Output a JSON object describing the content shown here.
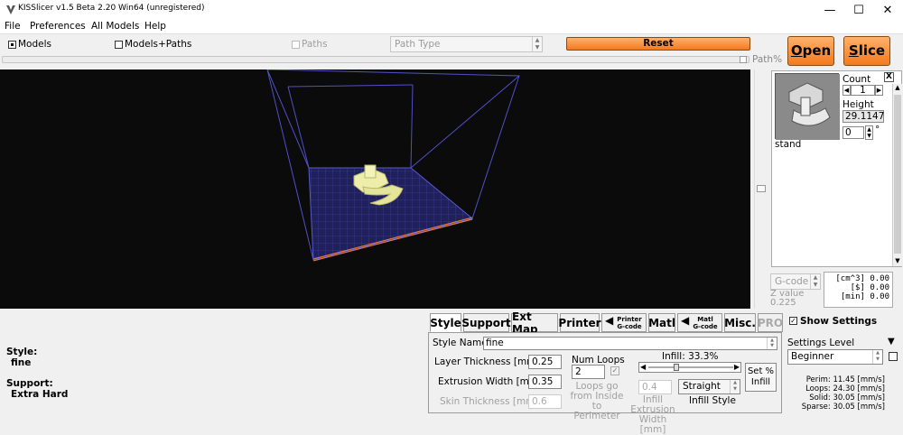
{
  "window": {
    "title": "KISSlicer v1.5 Beta 2.20 Win64 (unregistered)",
    "minimize": "—",
    "maximize": "☐",
    "close": "✕"
  },
  "menu": [
    "File",
    "Preferences",
    "All Models",
    "Help"
  ],
  "toolbar": {
    "models": "Models",
    "models_paths": "Models+Paths",
    "paths": "Paths",
    "path_type": "Path Type",
    "reset": "Reset",
    "path_pct": "Path%"
  },
  "buttons": {
    "open_pre": "",
    "open_ul": "O",
    "open_post": "pen",
    "slice_pre": "",
    "slice_ul": "S",
    "slice_post": "lice"
  },
  "model_panel": {
    "close": "X",
    "count_label": "Count",
    "count_value": "1",
    "height_label": "Height",
    "height_value": "29.1147",
    "angle_value": "0",
    "degree": "°",
    "model_name": "stand"
  },
  "gcode": {
    "combo": "G-code",
    "z_label": "Z value",
    "z_value": "0.225",
    "stats": [
      "[cm^3] 0.00",
      "[$] 0.00",
      "[min] 0.00"
    ]
  },
  "left_summary": {
    "style_label": "Style:",
    "style_value": "fine",
    "support_label": "Support:",
    "support_value": "Extra Hard"
  },
  "tabs": [
    "Style",
    "Support",
    "Ext Map",
    "Printer",
    "Matl",
    "Misc.",
    "PRO"
  ],
  "tab_printer_gcode": [
    "Printer",
    "G-code"
  ],
  "tab_matl_gcode": [
    "Matl",
    "G-code"
  ],
  "style_tab": {
    "style_name_label": "Style Name",
    "style_name_value": "fine",
    "layer_thickness_label": "Layer Thickness [mm]",
    "layer_thickness_value": "0.25",
    "extrusion_width_label": "Extrusion Width [mm]",
    "extrusion_width_value": "0.35",
    "skin_thickness_label": "Skin Thickness [mm]",
    "skin_thickness_value": "0.6",
    "num_loops_label": "Num Loops",
    "num_loops_value": "2",
    "loops_note": [
      "Loops go",
      "from Inside",
      "to Perimeter"
    ],
    "infill_label": "Infill: 33.3%",
    "infill_fraction": 0.333,
    "set_infill_label": [
      "Set %",
      "Infill"
    ],
    "infill_extrusion_label": [
      "Infill Extrusion",
      "Width [mm]"
    ],
    "infill_extrusion_value": "0.4",
    "infill_style_value": "Straight",
    "infill_style_label": "Infill Style"
  },
  "settings": {
    "show_settings": "Show Settings",
    "level_label": "Settings Level",
    "level_value": "Beginner",
    "speeds": [
      "Perim: 11.45 [mm/s]",
      "Loops: 24.30 [mm/s]",
      "Solid: 30.05 [mm/s]",
      "Sparse: 30.05 [mm/s]"
    ]
  }
}
